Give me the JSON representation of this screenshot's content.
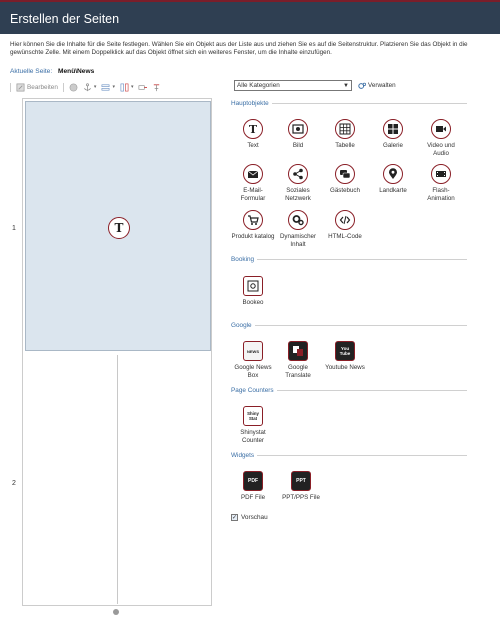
{
  "header": {
    "title": "Erstellen der Seiten"
  },
  "description": "Hier können Sie die Inhalte für die Seite festlegen. Wählen Sie ein Objekt aus der Liste aus und ziehen Sie es auf die Seitenstruktur. Platzieren Sie das Objekt in die gewünschte Zelle.  Mit einem Doppelklick auf das Objekt öffnet sich ein weiteres Fenster, um die Inhalte einzufügen.",
  "current_page": {
    "label": "Aktuelle Seite:",
    "value": "Menü\\News"
  },
  "toolbar": {
    "edit_label": "Bearbeiten"
  },
  "grid": {
    "row1_number": "1",
    "row2_number": "2",
    "row1_icon": "text-icon"
  },
  "category_select": {
    "value": "Alle Kategorien"
  },
  "manage_label": "Verwalten",
  "sections": {
    "main": {
      "title": "Hauptobjekte",
      "items": [
        {
          "label": "Text",
          "icon": "text-icon"
        },
        {
          "label": "Bild",
          "icon": "image-icon"
        },
        {
          "label": "Tabelle",
          "icon": "table-icon"
        },
        {
          "label": "Galerie",
          "icon": "gallery-icon"
        },
        {
          "label": "Video und Audio",
          "icon": "video-icon"
        },
        {
          "label": "E-Mail-Formular",
          "icon": "email-icon"
        },
        {
          "label": "Soziales Netzwerk",
          "icon": "share-icon"
        },
        {
          "label": "Gästebuch",
          "icon": "guestbook-icon"
        },
        {
          "label": "Landkarte",
          "icon": "map-pin-icon"
        },
        {
          "label": "Flash-Animation",
          "icon": "film-icon"
        },
        {
          "label": "Produkt katalog",
          "icon": "cart-icon"
        },
        {
          "label": "Dynamischer Inhalt",
          "icon": "gears-icon"
        },
        {
          "label": "HTML-Code",
          "icon": "code-icon"
        }
      ]
    },
    "booking": {
      "title": "Booking",
      "items": [
        {
          "label": "Bookeo",
          "icon": "bookeo-icon"
        }
      ]
    },
    "google": {
      "title": "Google",
      "items": [
        {
          "label": "Google News Box",
          "icon": "google-news-icon",
          "badge": "NEWS"
        },
        {
          "label": "Google Translate",
          "icon": "google-translate-icon"
        },
        {
          "label": "Youtube News",
          "icon": "youtube-icon",
          "badge_top": "You",
          "badge_bottom": "Tube"
        }
      ]
    },
    "counters": {
      "title": "Page Counters",
      "items": [
        {
          "label": "Shinystat Counter",
          "icon": "shinystat-icon",
          "badge_top": "Shiny",
          "badge_bottom": "Stat"
        }
      ]
    },
    "widgets": {
      "title": "Widgets",
      "items": [
        {
          "label": "PDF File",
          "icon": "pdf-file-icon",
          "badge": "PDF"
        },
        {
          "label": "PPT/PPS File",
          "icon": "ppt-file-icon",
          "badge": "PPT"
        }
      ]
    }
  },
  "preview": {
    "label": "Vorschau",
    "checked": true
  },
  "colors": {
    "header_bg": "#2f3f52",
    "accent": "#8a1f27",
    "link": "#3a6ea5",
    "cell_bg": "#dbe5ee"
  }
}
